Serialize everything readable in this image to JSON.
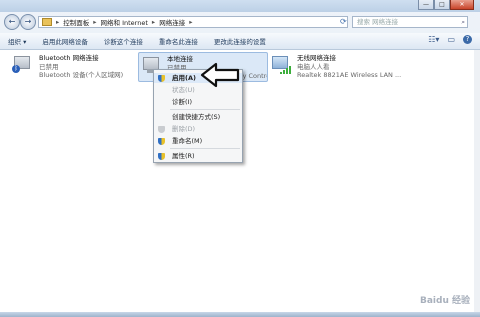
{
  "window": {
    "caption_min": "—",
    "caption_max": "□",
    "caption_close": "✕"
  },
  "nav": {
    "back": "←",
    "forward": "→",
    "address": [
      "控制面板",
      "网络和 Internet",
      "网络连接"
    ],
    "search_placeholder": "搜索 网络连接"
  },
  "toolbar": {
    "items": [
      "组织 ▾",
      "启用此网络设备",
      "诊断这个连接",
      "重命名此连接",
      "更改此连接的设置"
    ]
  },
  "connections": [
    {
      "name": "Bluetooth 网络连接",
      "status": "已禁用",
      "device": "Bluetooth 设备(个人区域网)"
    },
    {
      "name": "本地连接",
      "status": "已禁用",
      "device": "Realtek PCIe GBE Family Controller"
    },
    {
      "name": "无线网络连接",
      "status": "电脑人人看",
      "device": "Realtek 8821AE Wireless LAN ..."
    }
  ],
  "menu": {
    "items": [
      {
        "label": "启用(A)",
        "enabled": true,
        "bold": true
      },
      {
        "label": "状态(U)",
        "enabled": false
      },
      {
        "label": "诊断(I)",
        "enabled": true
      },
      {
        "label": "创建快捷方式(S)",
        "enabled": true
      },
      {
        "label": "删除(D)",
        "enabled": false
      },
      {
        "label": "重命名(M)",
        "enabled": true
      },
      {
        "label": "属性(R)",
        "enabled": true
      }
    ]
  },
  "watermark": "Baidu 经验",
  "colors": {
    "accent": "#3b6aa8",
    "selection": "#dbe8f7",
    "shield_blue": "#2f6fc4",
    "shield_yellow": "#e8c12a"
  }
}
